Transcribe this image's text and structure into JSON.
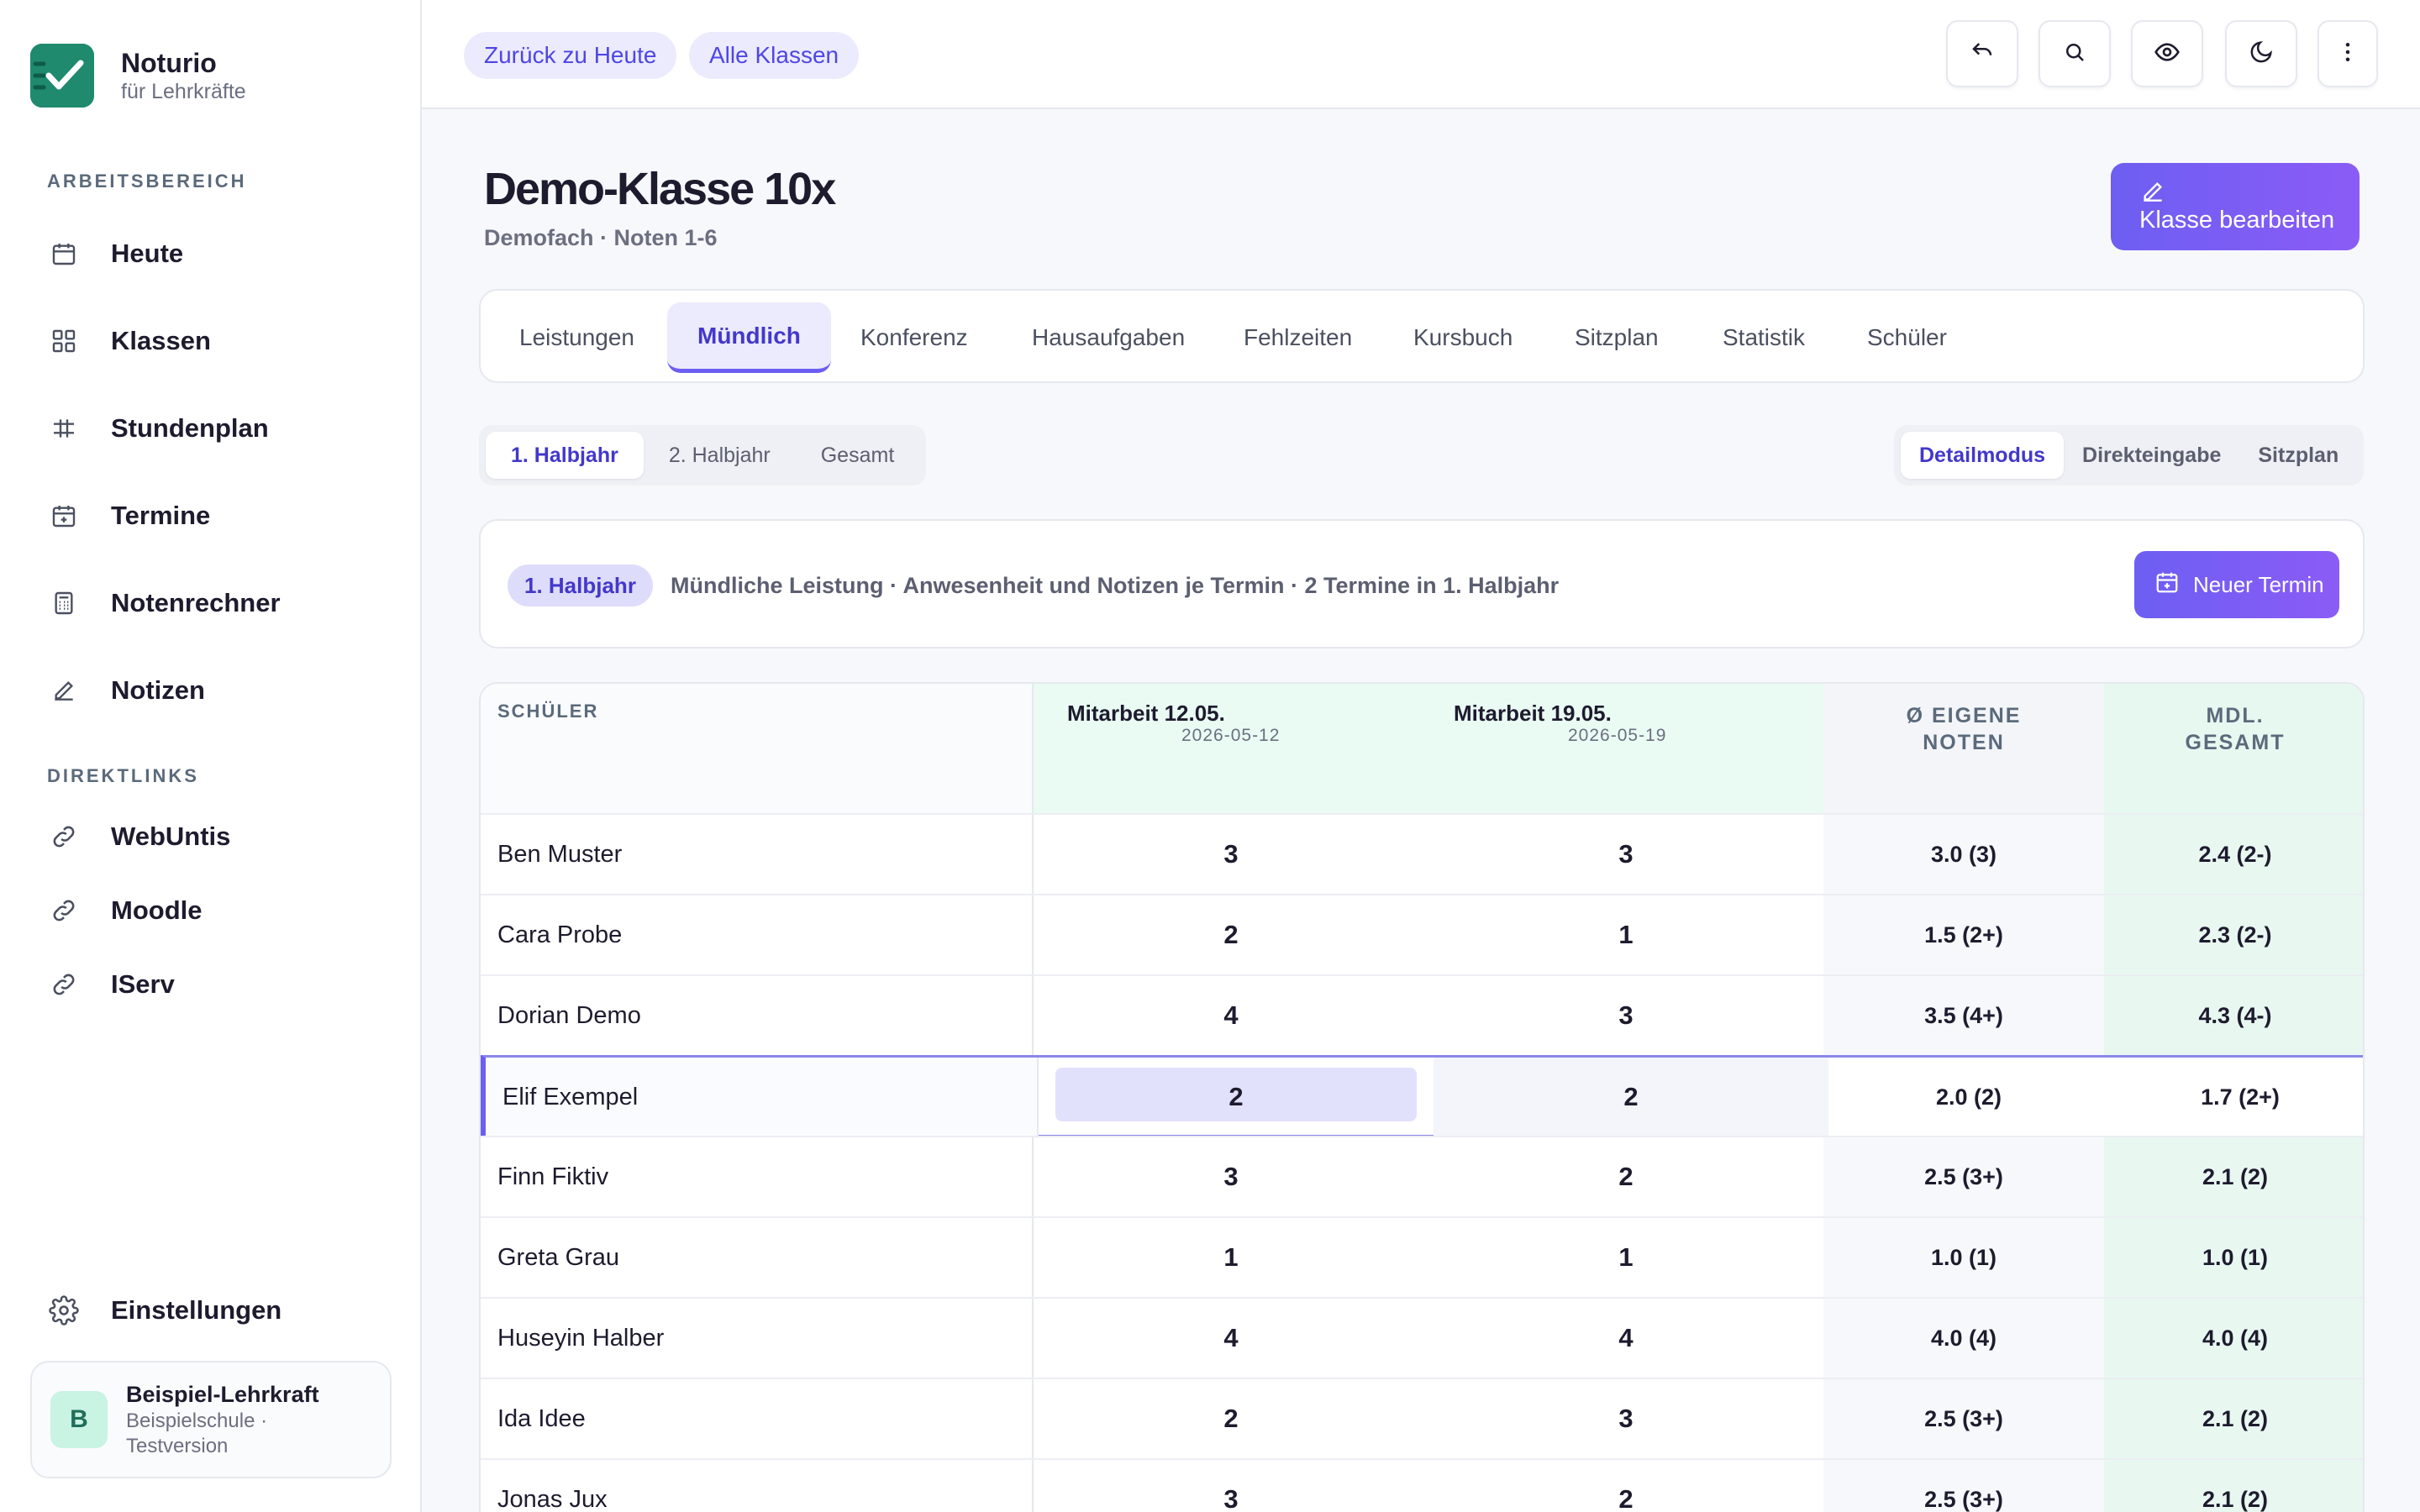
{
  "brand": {
    "name": "Noturio",
    "subtitle": "für Lehrkräfte"
  },
  "sidebar": {
    "section_workspace": "ARBEITSBEREICH",
    "items": [
      {
        "label": "Heute",
        "icon": "calendar-icon"
      },
      {
        "label": "Klassen",
        "icon": "grid-icon"
      },
      {
        "label": "Stundenplan",
        "icon": "timetable-icon"
      },
      {
        "label": "Termine",
        "icon": "calendar-plus-icon"
      },
      {
        "label": "Notenrechner",
        "icon": "calculator-icon"
      },
      {
        "label": "Notizen",
        "icon": "pencil-icon"
      }
    ],
    "section_links": "DIREKTLINKS",
    "links": [
      {
        "label": "WebUntis",
        "icon": "link-icon"
      },
      {
        "label": "Moodle",
        "icon": "link-icon"
      },
      {
        "label": "IServ",
        "icon": "link-icon"
      }
    ],
    "settings": "Einstellungen",
    "user": {
      "initial": "B",
      "name": "Beispiel-Lehrkraft",
      "meta": "Beispielschule · Testversion"
    }
  },
  "topbar": {
    "back_today": "Zurück zu Heute",
    "all_classes": "Alle Klassen",
    "icons": [
      "undo-icon",
      "search-icon",
      "eye-icon",
      "moon-icon",
      "more-vertical-icon"
    ]
  },
  "header": {
    "title": "Demo-Klasse 10x",
    "subtitle": "Demofach · Noten 1-6",
    "edit_button": "Klasse bearbeiten"
  },
  "tabs": [
    "Leistungen",
    "Mündlich",
    "Konferenz",
    "Hausaufgaben",
    "Fehlzeiten",
    "Kursbuch",
    "Sitzplan",
    "Statistik",
    "Schüler"
  ],
  "active_tab": "Mündlich",
  "terms": [
    "1. Halbjahr",
    "2. Halbjahr",
    "Gesamt"
  ],
  "active_term": "1. Halbjahr",
  "modes": [
    "Detailmodus",
    "Direkteingabe",
    "Sitzplan"
  ],
  "active_mode": "Detailmodus",
  "info": {
    "badge": "1. Halbjahr",
    "text": "Mündliche Leistung · Anwesenheit und Notizen je Termin · 2 Termine in 1. Halbjahr",
    "new_button": "Neuer Termin"
  },
  "table": {
    "col_student": "SCHÜLER",
    "col_a_title": "Mitarbeit 12.05.",
    "col_a_date": "2026-05-12",
    "col_b_title": "Mitarbeit 19.05.",
    "col_b_date": "2026-05-19",
    "col_avg_1": "Ø EIGENE",
    "col_avg_2": "NOTEN",
    "col_tot_1": "MDL.",
    "col_tot_2": "GESAMT",
    "rows": [
      {
        "name": "Ben Muster",
        "a": "3",
        "b": "3",
        "avg": "3.0 (3)",
        "total": "2.4 (2-)"
      },
      {
        "name": "Cara Probe",
        "a": "2",
        "b": "1",
        "avg": "1.5 (2+)",
        "total": "2.3 (2-)"
      },
      {
        "name": "Dorian Demo",
        "a": "4",
        "b": "3",
        "avg": "3.5 (4+)",
        "total": "4.3 (4-)"
      },
      {
        "name": "Elif Exempel",
        "a": "2",
        "b": "2",
        "avg": "2.0 (2)",
        "total": "1.7 (2+)"
      },
      {
        "name": "Finn Fiktiv",
        "a": "3",
        "b": "2",
        "avg": "2.5 (3+)",
        "total": "2.1 (2)"
      },
      {
        "name": "Greta Grau",
        "a": "1",
        "b": "1",
        "avg": "1.0 (1)",
        "total": "1.0 (1)"
      },
      {
        "name": "Huseyin Halber",
        "a": "4",
        "b": "4",
        "avg": "4.0 (4)",
        "total": "4.0 (4)"
      },
      {
        "name": "Ida Idee",
        "a": "2",
        "b": "3",
        "avg": "2.5 (3+)",
        "total": "2.1 (2)"
      },
      {
        "name": "Jonas Jux",
        "a": "3",
        "b": "2",
        "avg": "2.5 (3+)",
        "total": "2.1 (2)"
      }
    ]
  },
  "colors": {
    "accent": "#6d5ef2",
    "brand": "#1f8a6e",
    "grade_column": "#e9fbf3"
  }
}
